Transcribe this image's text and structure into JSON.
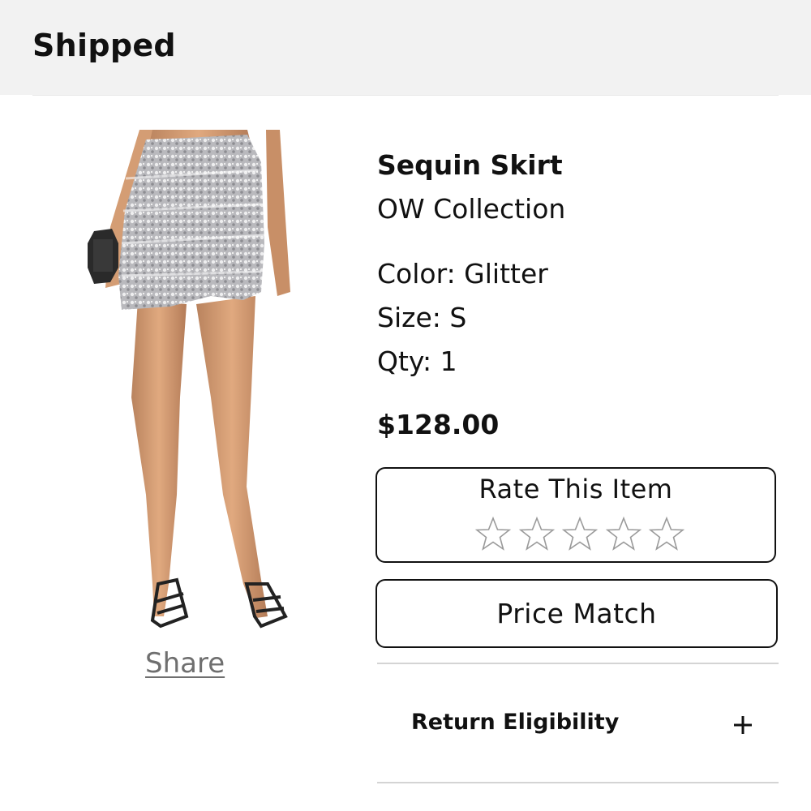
{
  "header": {
    "title": "Shipped"
  },
  "product": {
    "image_alt": "Model wearing silver sequin mini skirt",
    "name": "Sequin Skirt",
    "brand": "OW Collection",
    "color": "Color: Glitter",
    "size": "Size: S",
    "qty": "Qty: 1",
    "price": "$128.00"
  },
  "share": {
    "label": "Share"
  },
  "rating": {
    "label": "Rate This Item",
    "stars_total": 5,
    "stars_filled": 0
  },
  "price_match": {
    "label": "Price Match"
  },
  "return_eligibility": {
    "label": "Return Eligibility",
    "icon": "plus-icon"
  },
  "colors": {
    "header_bg": "#f2f2f2",
    "text": "#111111",
    "share": "#6f6f6f",
    "star_stroke": "#9a9a9a"
  }
}
